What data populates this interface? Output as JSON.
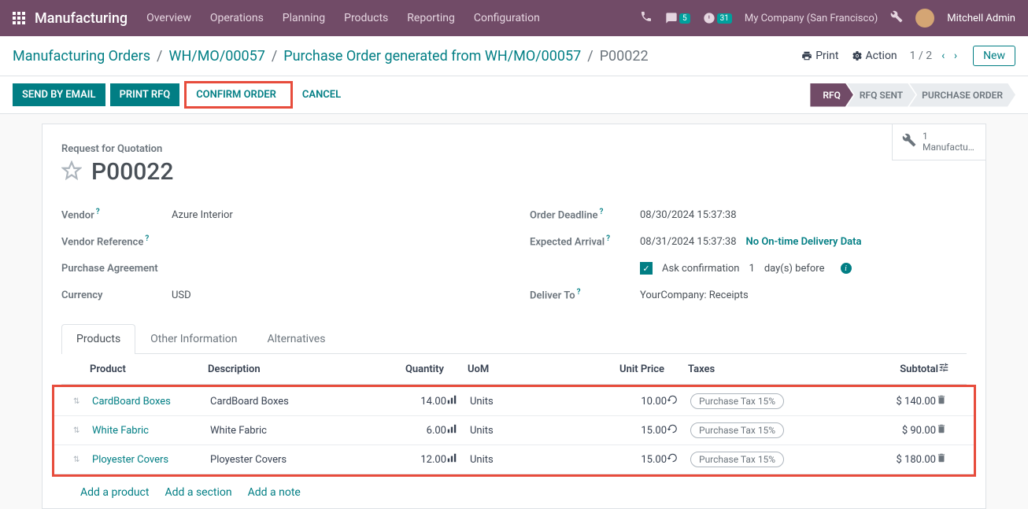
{
  "topbar": {
    "app_title": "Manufacturing",
    "menu": [
      "Overview",
      "Operations",
      "Planning",
      "Products",
      "Reporting",
      "Configuration"
    ],
    "chat_badge": "5",
    "clock_badge": "31",
    "company": "My Company (San Francisco)",
    "user": "Mitchell Admin"
  },
  "breadcrumb": {
    "items": [
      "Manufacturing Orders",
      "WH/MO/00057",
      "Purchase Order generated from WH/MO/00057"
    ],
    "current": "P00022"
  },
  "subbar": {
    "print": "Print",
    "action": "Action",
    "pager": "1 / 2",
    "new": "New"
  },
  "actions": {
    "send_email": "SEND BY EMAIL",
    "print_rfq": "PRINT RFQ",
    "confirm": "CONFIRM ORDER",
    "cancel": "CANCEL"
  },
  "status": [
    "RFQ",
    "RFQ SENT",
    "PURCHASE ORDER"
  ],
  "smart_btn": {
    "count": "1",
    "label": "Manufactu…"
  },
  "form": {
    "type_label": "Request for Quotation",
    "name": "P00022",
    "fields_left": {
      "vendor_label": "Vendor",
      "vendor_value": "Azure Interior",
      "vendor_ref_label": "Vendor Reference",
      "vendor_ref_value": "",
      "agreement_label": "Purchase Agreement",
      "agreement_value": "",
      "currency_label": "Currency",
      "currency_value": "USD"
    },
    "fields_right": {
      "deadline_label": "Order Deadline",
      "deadline_value": "08/30/2024 15:37:38",
      "arrival_label": "Expected Arrival",
      "arrival_value": "08/31/2024 15:37:38",
      "delivery_link": "No On-time Delivery Data",
      "ask_conf": "Ask confirmation",
      "ask_conf_days": "1",
      "days_before": "day(s) before",
      "deliver_label": "Deliver To",
      "deliver_value": "YourCompany: Receipts"
    }
  },
  "tabs": [
    "Products",
    "Other Information",
    "Alternatives"
  ],
  "table": {
    "headers": {
      "product": "Product",
      "description": "Description",
      "quantity": "Quantity",
      "uom": "UoM",
      "unit_price": "Unit Price",
      "taxes": "Taxes",
      "subtotal": "Subtotal"
    },
    "rows": [
      {
        "product": "CardBoard Boxes",
        "description": "CardBoard Boxes",
        "quantity": "14.00",
        "uom": "Units",
        "unit_price": "10.00",
        "tax": "Purchase Tax 15%",
        "subtotal": "$ 140.00"
      },
      {
        "product": "White Fabric",
        "description": "White Fabric",
        "quantity": "6.00",
        "uom": "Units",
        "unit_price": "15.00",
        "tax": "Purchase Tax 15%",
        "subtotal": "$ 90.00"
      },
      {
        "product": "Ployester Covers",
        "description": "Ployester Covers",
        "quantity": "12.00",
        "uom": "Units",
        "unit_price": "15.00",
        "tax": "Purchase Tax 15%",
        "subtotal": "$ 180.00"
      }
    ],
    "add_product": "Add a product",
    "add_section": "Add a section",
    "add_note": "Add a note"
  }
}
